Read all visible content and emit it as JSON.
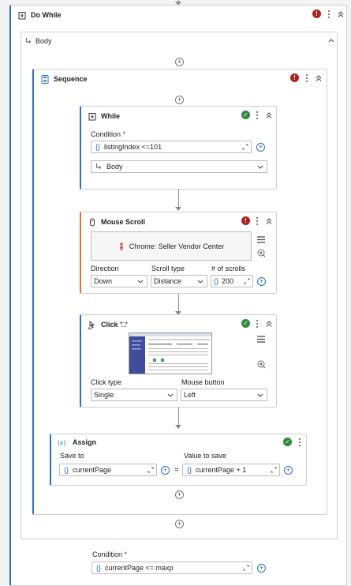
{
  "do_while": {
    "title": "Do While",
    "body_label": "Body",
    "condition_label": "Condition",
    "condition_required": "*",
    "condition_value": "currentPage <= maxp"
  },
  "sequence": {
    "title": "Sequence"
  },
  "while": {
    "title": "While",
    "condition_label": "Condition",
    "condition_required": "*",
    "condition_value": "listingIndex <=101",
    "body_label": "Body"
  },
  "mouse_scroll": {
    "title": "Mouse Scroll",
    "target_label": "Chrome: Seller Vendor Center",
    "direction_label": "Direction",
    "direction_value": "Down",
    "scroll_type_label": "Scroll type",
    "scroll_type_value": "Distance",
    "num_scrolls_label": "# of scrolls",
    "num_scrolls_value": "200"
  },
  "click": {
    "title": "Click '\u0000'",
    "title_display": "Click '□'",
    "click_type_label": "Click type",
    "click_type_value": "Single",
    "mouse_button_label": "Mouse button",
    "mouse_button_value": "Left"
  },
  "assign": {
    "title": "Assign",
    "save_to_label": "Save to",
    "save_to_value": "currentPage",
    "value_label": "Value to save",
    "value_value": "currentPage + 1",
    "equals": "="
  },
  "common": {
    "brace": "{}",
    "error_mark": "!",
    "ok_mark": "✓",
    "plus": "+"
  },
  "colors": {
    "accent": "#2d6fc7",
    "error": "#b3201c",
    "ok": "#2e8b3e",
    "mouse_scroll_bar": "#e8702a",
    "activity_bar": "#2d6fc7"
  }
}
